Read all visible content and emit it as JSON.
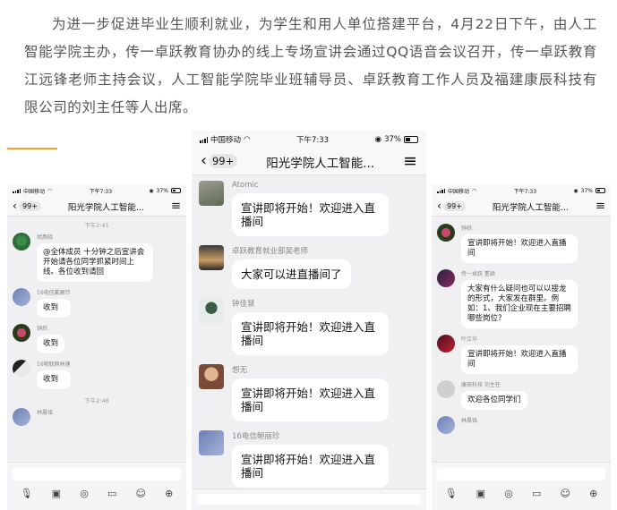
{
  "article": {
    "paragraph": "为进一步促进毕业生顺利就业，为学生和用人单位搭建平台，4月22日下午，由人工智能学院主办，传一卓跃教育协办的线上专场宣讲会通过QQ语音会议召开，传一卓跃教育江远锋老师主持会议，人工智能学院毕业班辅导员、卓跃教育工作人员及福建康辰科技有限公司的刘主任等人出席。"
  },
  "phones": {
    "left": {
      "status": {
        "carrier": "中国移动",
        "time": "下午7:33",
        "battery": "37%"
      },
      "nav": {
        "back_count": "99+",
        "title": "阳光学院人工智能...",
        "menu_icon": "menu-icon"
      },
      "timestamp_1": "下午2:41",
      "messages": [
        {
          "sender": "胡燕晓",
          "text": "@全体成员 十分钟之后宣讲会开始请各位同学抓紧时间上线。各位收到请回"
        },
        {
          "sender": "16电信戴雁玲",
          "text": "收到"
        },
        {
          "sender": "钟舒.",
          "text": "收到"
        },
        {
          "sender": "16物联网林建",
          "text": "收到"
        }
      ],
      "timestamp_2": "下午2:46",
      "last_sender": "林晨铭"
    },
    "center": {
      "status": {
        "carrier": "中国移动",
        "time": "下午7:33",
        "battery": "37%"
      },
      "nav": {
        "back_count": "99+",
        "title": "阳光学院人工智能...",
        "menu_icon": "menu-icon"
      },
      "messages": [
        {
          "sender": "Atomic",
          "text": "宣讲即将开始！欢迎进入直播间"
        },
        {
          "sender": "卓跃教育就业部吴老师",
          "text": "大家可以进直播间了"
        },
        {
          "sender": "钟佳慧",
          "text": "宣讲即将开始！欢迎进入直播间"
        },
        {
          "sender": "想无",
          "text": "宣讲即将开始！欢迎进入直播间"
        },
        {
          "sender": "16电信鲍丽珍",
          "text": "宣讲即将开始！欢迎进入直播间"
        }
      ]
    },
    "right": {
      "status": {
        "carrier": "中国移动",
        "time": "下午7:33",
        "battery": "37%"
      },
      "nav": {
        "back_count": "99+",
        "title": "阳光学院人工智能...",
        "menu_icon": "menu-icon"
      },
      "messages": [
        {
          "sender": "钟舒.",
          "text": "宣讲即将开始！欢迎进入直播间"
        },
        {
          "sender": "传一卓跃 董颖",
          "text": "大家有什么疑问也可以以接龙的形式，大家发在群里。例如：1、我们企业现在主要招聘哪些岗位？"
        },
        {
          "sender": "叶江华",
          "text": "宣讲即将开始！欢迎进入直播间"
        },
        {
          "sender": "康辰科技 刘主任",
          "text": "欢迎各位同学们"
        }
      ],
      "last_sender": "林晨铭"
    }
  },
  "toolbar_icons": [
    "voice-icon",
    "image-icon",
    "camera-icon",
    "folder-icon",
    "emoji-icon",
    "plus-icon"
  ]
}
